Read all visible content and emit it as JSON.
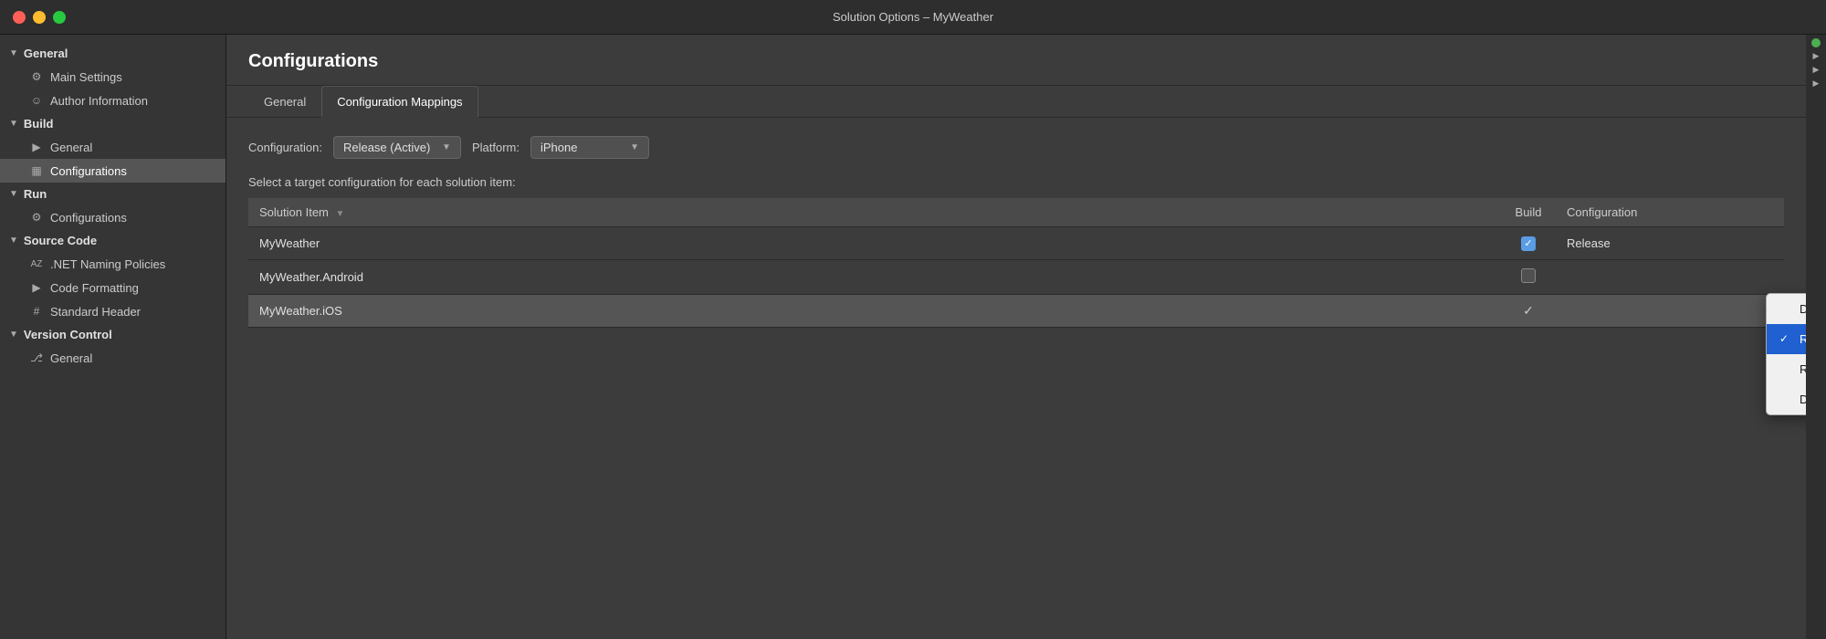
{
  "titleBar": {
    "title": "Solution Options – MyWeather",
    "buttons": {
      "close": "close",
      "minimize": "minimize",
      "maximize": "maximize"
    }
  },
  "sidebar": {
    "sections": [
      {
        "id": "general",
        "label": "General",
        "expanded": true,
        "items": [
          {
            "id": "main-settings",
            "label": "Main Settings",
            "icon": "⚙",
            "active": false
          },
          {
            "id": "author-information",
            "label": "Author Information",
            "icon": "☺",
            "active": false
          }
        ]
      },
      {
        "id": "build",
        "label": "Build",
        "expanded": true,
        "items": [
          {
            "id": "build-general",
            "label": "General",
            "icon": "▶",
            "active": false
          },
          {
            "id": "configurations",
            "label": "Configurations",
            "icon": "▦",
            "active": true
          }
        ]
      },
      {
        "id": "run",
        "label": "Run",
        "expanded": true,
        "items": [
          {
            "id": "run-configurations",
            "label": "Configurations",
            "icon": "⚙",
            "active": false
          }
        ]
      },
      {
        "id": "source-code",
        "label": "Source Code",
        "expanded": true,
        "items": [
          {
            "id": "net-naming",
            "label": ".NET Naming Policies",
            "icon": "A̲Z",
            "active": false
          },
          {
            "id": "code-formatting",
            "label": "Code Formatting",
            "icon": "▶",
            "active": false
          },
          {
            "id": "standard-header",
            "label": "Standard Header",
            "icon": "#",
            "active": false
          }
        ]
      },
      {
        "id": "version-control",
        "label": "Version Control",
        "expanded": true,
        "items": [
          {
            "id": "vc-general",
            "label": "General",
            "icon": "⎇",
            "active": false
          }
        ]
      }
    ]
  },
  "content": {
    "title": "Configurations",
    "tabs": [
      {
        "id": "general-tab",
        "label": "General",
        "active": false
      },
      {
        "id": "config-mappings-tab",
        "label": "Configuration Mappings",
        "active": true
      }
    ],
    "configRow": {
      "configLabel": "Configuration:",
      "configValue": "Release (Active)",
      "platformLabel": "Platform:",
      "platformValue": "iPhone"
    },
    "tableDescription": "Select a target configuration for each solution item:",
    "tableHeaders": {
      "solutionItem": "Solution Item",
      "build": "Build",
      "configuration": "Configuration"
    },
    "tableRows": [
      {
        "id": "myweather",
        "name": "MyWeather",
        "checked": true,
        "configuration": "Release",
        "highlighted": false,
        "showDropdown": false
      },
      {
        "id": "myweather-android",
        "name": "MyWeather.Android",
        "checked": false,
        "configuration": "",
        "highlighted": false,
        "showDropdown": false
      },
      {
        "id": "myweather-ios",
        "name": "MyWeather.iOS",
        "checked": true,
        "configuration": "",
        "highlighted": true,
        "showDropdown": true
      }
    ],
    "dropdown": {
      "items": [
        {
          "id": "debug-iphone-sim",
          "label": "Debug|iPhoneSimulator",
          "selected": false
        },
        {
          "id": "release-iphone",
          "label": "Release|iPhone",
          "selected": true
        },
        {
          "id": "release-iphone-sim",
          "label": "Release|iPhoneSimulator",
          "selected": false
        },
        {
          "id": "debug-iphone",
          "label": "Debug|iPhone",
          "selected": false
        }
      ]
    }
  }
}
